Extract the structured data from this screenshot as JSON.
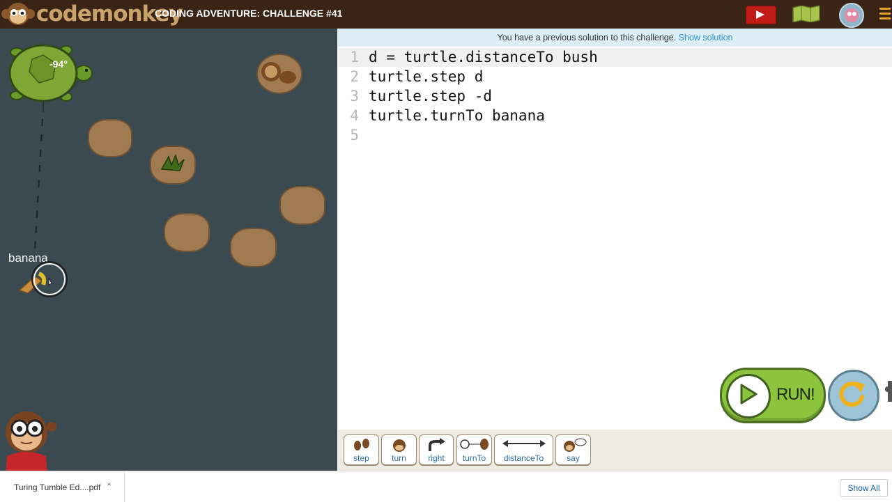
{
  "header": {
    "logo_text": "codemonkey",
    "challenge_title": "CODING ADVENTURE: CHALLENGE #41"
  },
  "game": {
    "turtle_angle": "-94°",
    "banana_label": "banana"
  },
  "notice": {
    "text": "You have a previous solution to this challenge.",
    "link": "Show solution"
  },
  "code": {
    "lines": [
      {
        "num": "1",
        "text": "d = turtle.distanceTo bush"
      },
      {
        "num": "2",
        "text": "turtle.step d"
      },
      {
        "num": "3",
        "text": "turtle.step -d"
      },
      {
        "num": "4",
        "text": "turtle.turnTo banana"
      },
      {
        "num": "5",
        "text": ""
      }
    ]
  },
  "controls": {
    "run_label": "RUN!"
  },
  "palette": [
    {
      "label": "step",
      "icon": "footsteps-icon"
    },
    {
      "label": "turn",
      "icon": "turn-icon"
    },
    {
      "label": "right",
      "icon": "right-arrow-icon"
    },
    {
      "label": "turnTo",
      "icon": "turnto-icon"
    },
    {
      "label": "distanceTo",
      "icon": "distance-icon"
    },
    {
      "label": "say",
      "icon": "speech-icon"
    }
  ],
  "download": {
    "filename": "Turing Tumble Ed....pdf",
    "show_all": "Show All"
  },
  "colors": {
    "topbar": "#3a2416",
    "game_bg": "#3b4a50",
    "run_green": "#8cc43e",
    "link_blue": "#2a8fd0"
  }
}
